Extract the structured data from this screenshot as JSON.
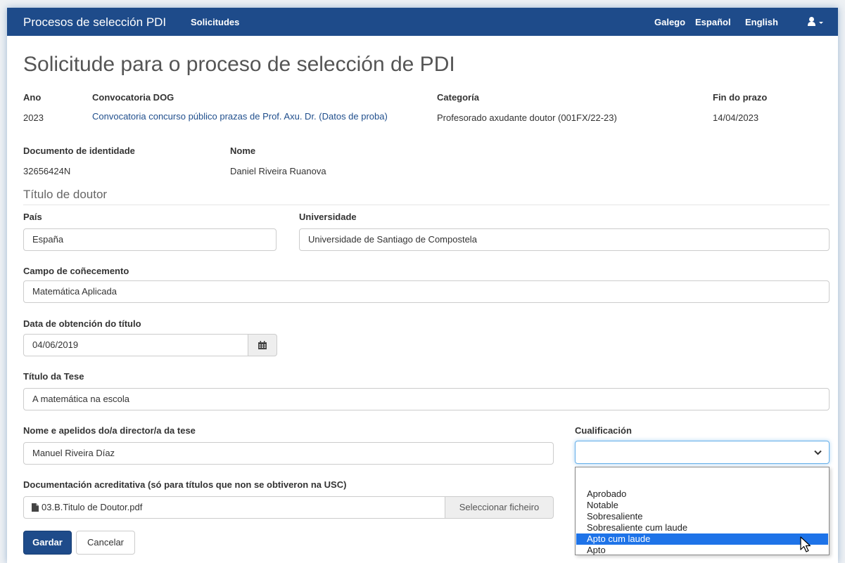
{
  "navbar": {
    "brand": "Procesos de selección PDI",
    "solicitudes": "Solicitudes",
    "lang_gl": "Galego",
    "lang_es": "Español",
    "lang_en": "English"
  },
  "page": {
    "title": "Solicitude para o proceso de selección de PDI"
  },
  "summary": {
    "ano_label": "Ano",
    "ano_value": "2023",
    "convocatoria_label": "Convocatoria DOG",
    "convocatoria_value": "Convocatoria concurso público prazas de Prof. Axu. Dr. (Datos de proba)",
    "categoria_label": "Categoría",
    "categoria_value": "Profesorado axudante doutor (001FX/22-23)",
    "fin_label": "Fin do prazo",
    "fin_value": "14/04/2023",
    "doc_label": "Documento de identidade",
    "doc_value": "32656424N",
    "nome_label": "Nome",
    "nome_value": "Daniel Riveira Ruanova"
  },
  "section": {
    "title": "Título de doutor"
  },
  "form": {
    "pais_label": "País",
    "pais_value": "España",
    "universidade_label": "Universidade",
    "universidade_value": "Universidade de Santiago de Compostela",
    "campo_label": "Campo de coñecemento",
    "campo_value": "Matemática Aplicada",
    "data_label": "Data de obtención do título",
    "data_value": "04/06/2019",
    "tese_label": "Título da Tese",
    "tese_value": "A matemática na escola",
    "director_label": "Nome e apelidos do/a director/a da tese",
    "director_value": "Manuel Riveira Díaz",
    "cualificacion_label": "Cualificación",
    "cualificacion_value": "",
    "cualificacion_options": [
      "Aprobado",
      "Notable",
      "Sobresaliente",
      "Sobresaliente cum laude",
      "Apto cum laude",
      "Apto"
    ],
    "cualificacion_highlighted": "Apto cum laude",
    "doc_label": "Documentación acreditativa (só para títulos que non se obtiveron na USC)",
    "doc_file": "03.B.Titulo de Doutor.pdf",
    "doc_button": "Seleccionar ficheiro"
  },
  "actions": {
    "save": "Gardar",
    "cancel": "Cancelar"
  },
  "colors": {
    "navbar": "#1e4b8a",
    "link": "#1f4e8c",
    "highlight": "#1e73e8"
  },
  "icons": {
    "user": "user-icon",
    "calendar": "calendar-icon",
    "file": "file-icon",
    "chevron": "chevron-down-icon"
  }
}
